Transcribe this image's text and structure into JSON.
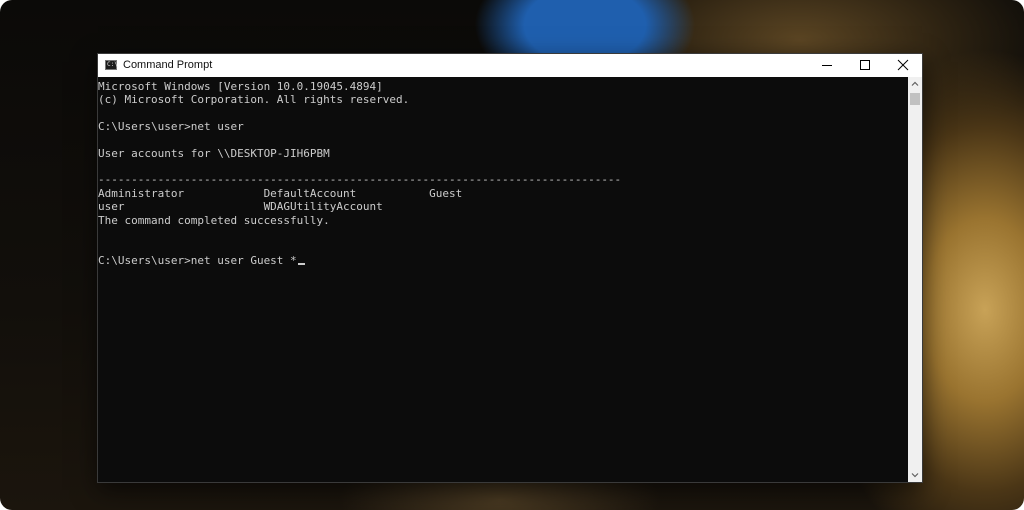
{
  "window": {
    "title": "Command Prompt",
    "icon": "cmd-icon",
    "controls": [
      "minimize",
      "maximize",
      "close"
    ]
  },
  "console": {
    "lines": [
      "Microsoft Windows [Version 10.0.19045.4894]",
      "(c) Microsoft Corporation. All rights reserved.",
      "",
      "C:\\Users\\user>net user",
      "",
      "User accounts for \\\\DESKTOP-JIH6PBM",
      "",
      "-------------------------------------------------------------------------------",
      "Administrator            DefaultAccount           Guest",
      "user                     WDAGUtilityAccount",
      "The command completed successfully.",
      "",
      ""
    ],
    "prompt": "C:\\Users\\user>net user Guest *"
  },
  "colors": {
    "console_bg": "#0c0c0c",
    "console_text": "#cccccc",
    "titlebar_bg": "#ffffff"
  }
}
